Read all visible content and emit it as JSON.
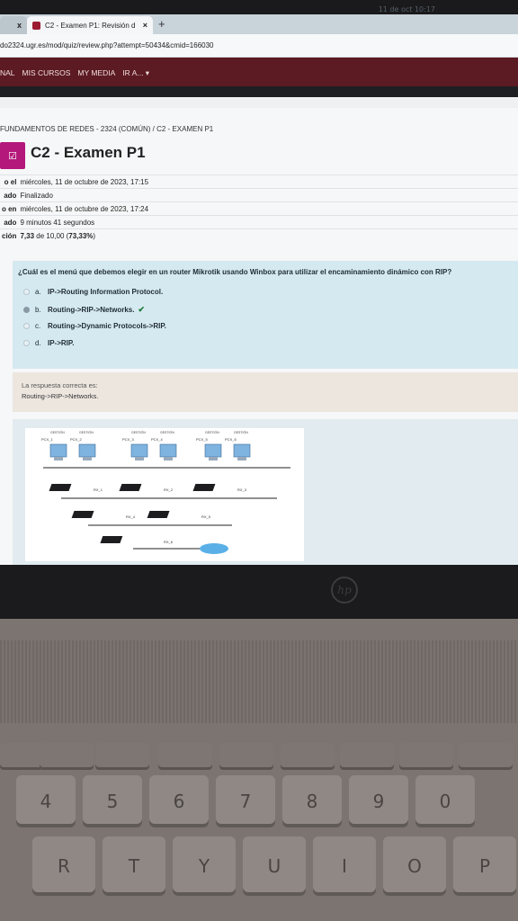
{
  "system": {
    "clock": "11 de oct  10:17"
  },
  "browser": {
    "prev_tab_label": "x",
    "tab_title": "C2 - Examen P1: Revisión d",
    "new_tab_label": "+",
    "url": "do2324.ugr.es/mod/quiz/review.php?attempt=50434&cmid=166030"
  },
  "nav": {
    "items": [
      "NAL",
      "MIS CURSOS",
      "MY MEDIA",
      "IR A... ▾"
    ]
  },
  "breadcrumb": "FUNDAMENTOS DE REDES - 2324 (COMÚN)  /  C2 - EXAMEN P1",
  "page_title": "C2 - Examen P1",
  "summary": [
    {
      "key": "o el",
      "value": "miércoles, 11 de octubre de 2023, 17:15"
    },
    {
      "key": "ado",
      "value": "Finalizado"
    },
    {
      "key": "o en",
      "value": "miércoles, 11 de octubre de 2023, 17:24"
    },
    {
      "key": "ado",
      "value": "9 minutos 41 segundos"
    },
    {
      "key": "ción",
      "value": "7,33 de 10,00 (73,33%)"
    }
  ],
  "question": {
    "text": "¿Cuál es el menú que debemos elegir en un router Mikrotik usando Winbox para utilizar el encaminamiento dinámico con RIP?",
    "options": [
      {
        "letter": "a.",
        "text": "IP->Routing Information Protocol."
      },
      {
        "letter": "b.",
        "text": "Routing->RIP->Networks.",
        "correct_mark": "✔"
      },
      {
        "letter": "c.",
        "text": "Routing->Dynamic Protocols->RIP."
      },
      {
        "letter": "d.",
        "text": "IP->RIP."
      }
    ]
  },
  "feedback": {
    "label": "La respuesta correcta es:",
    "answer": "Routing->RIP->Networks."
  },
  "diagram": {
    "routers": [
      "RX_1",
      "RX_2",
      "RX_3",
      "RX_4",
      "RX_5",
      "RX_6"
    ],
    "pcs": [
      "PCX_1",
      "PCX_2",
      "PCX_3",
      "PCX_4",
      "PCX_5",
      "PCX_6"
    ],
    "note": "GESTIÓN"
  },
  "keyboard": {
    "row1": [
      "4",
      "5",
      "6",
      "7",
      "8",
      "9",
      "0"
    ],
    "row2": [
      "R",
      "T",
      "Y",
      "U",
      "I",
      "O",
      "P"
    ]
  }
}
